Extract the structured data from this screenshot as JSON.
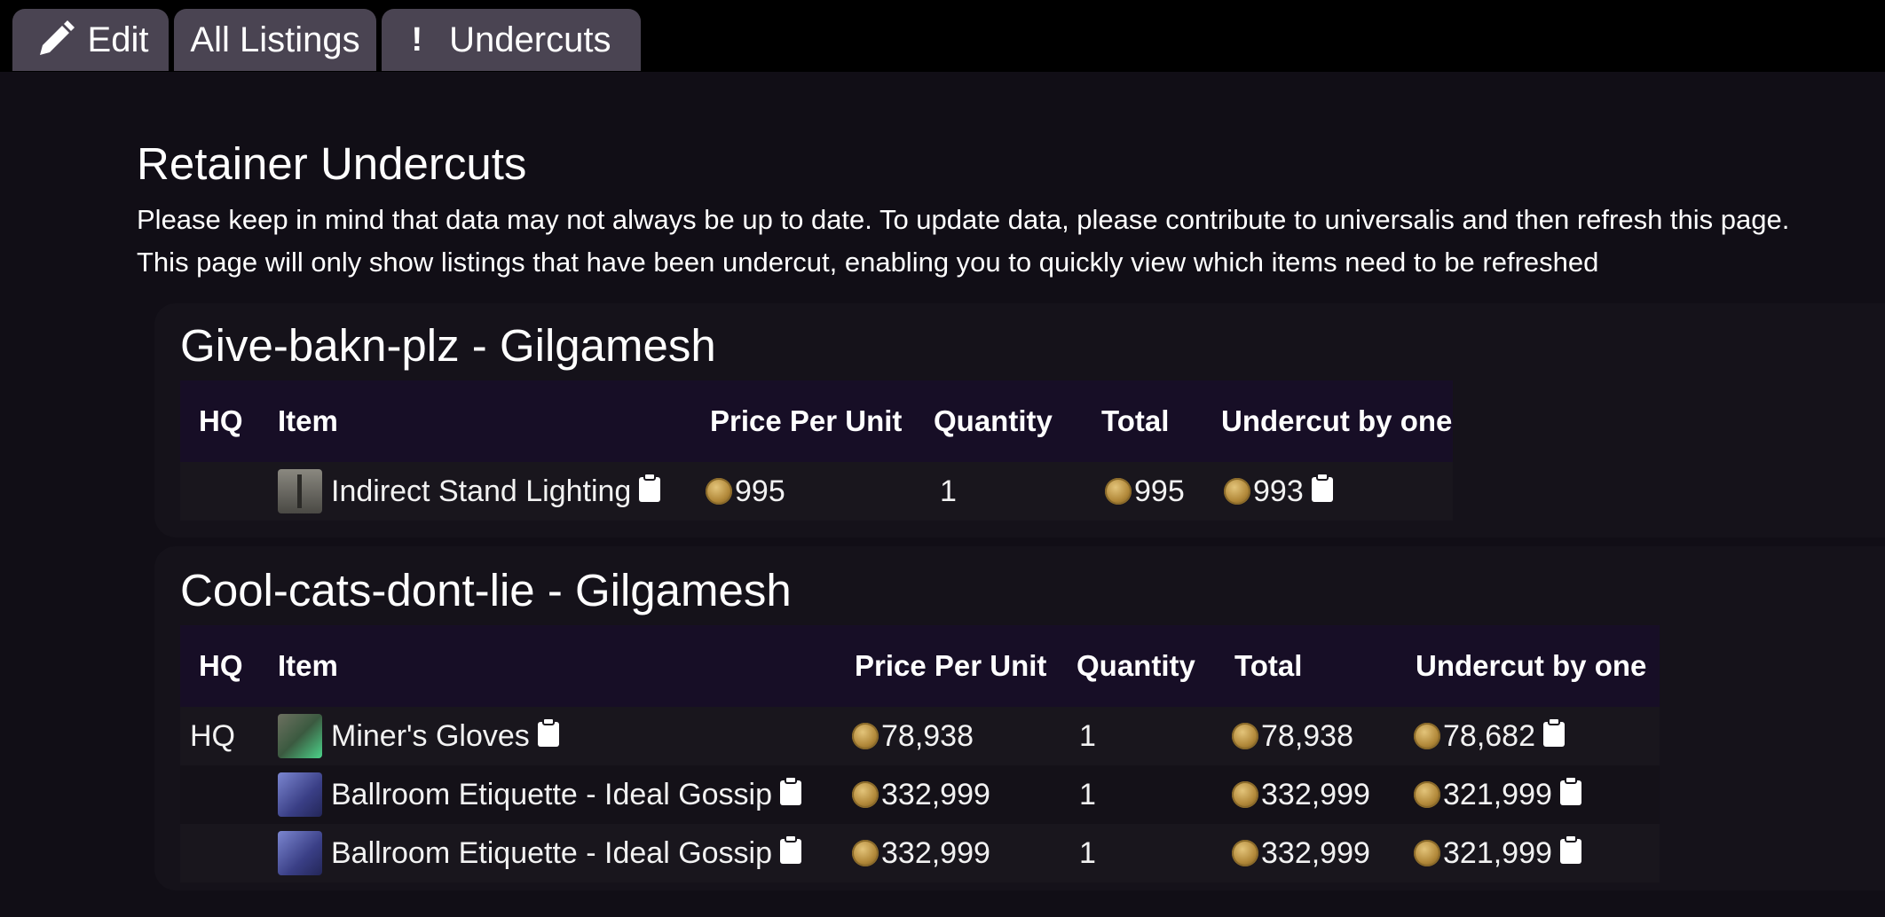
{
  "tabs": [
    {
      "label": "Edit",
      "icon": "pencil-icon"
    },
    {
      "label": "All Listings"
    },
    {
      "label": "Undercuts",
      "icon": "exclamation-icon"
    }
  ],
  "page": {
    "title": "Retainer Undercuts",
    "description_1": "Please keep in mind that data may not always be up to date. To update data, please contribute to universalis and then refresh this page.",
    "description_2": "This page will only show listings that have been undercut, enabling you to quickly view which items need to be refreshed"
  },
  "columns": {
    "hq": "HQ",
    "item": "Item",
    "price_per_unit": "Price Per Unit",
    "quantity": "Quantity",
    "total": "Total",
    "undercut_by_one": "Undercut by one"
  },
  "retainers": [
    {
      "title": "Give-bakn-plz - Gilgamesh",
      "rows": [
        {
          "hq": "",
          "item": "Indirect Stand Lighting",
          "icon": "stand-lighting-icon",
          "price": "995",
          "quantity": "1",
          "total": "995",
          "undercut": "993"
        }
      ]
    },
    {
      "title": "Cool-cats-dont-lie - Gilgamesh",
      "rows": [
        {
          "hq": "HQ",
          "item": "Miner's Gloves",
          "icon": "gloves-icon",
          "price": "78,938",
          "quantity": "1",
          "total": "78,938",
          "undercut": "78,682"
        },
        {
          "hq": "",
          "item": "Ballroom Etiquette - Ideal Gossip",
          "icon": "book-icon",
          "price": "332,999",
          "quantity": "1",
          "total": "332,999",
          "undercut": "321,999"
        },
        {
          "hq": "",
          "item": "Ballroom Etiquette - Ideal Gossip",
          "icon": "book-icon",
          "price": "332,999",
          "quantity": "1",
          "total": "332,999",
          "undercut": "321,999"
        }
      ]
    }
  ],
  "colors": {
    "topbar": "#000000",
    "tab": "#4a4452",
    "background": "#110e16",
    "table_header": "#170e26",
    "gil_coin": "#c9a04d"
  }
}
